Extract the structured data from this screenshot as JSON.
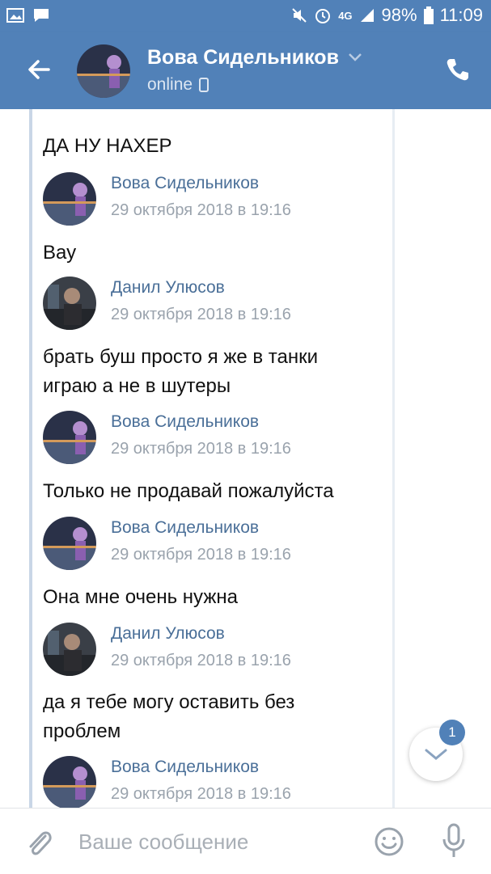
{
  "status_bar": {
    "network": "4G",
    "battery": "98%",
    "time": "11:09"
  },
  "header": {
    "contact_name": "Вова Сидельников",
    "status": "online",
    "back_icon": "arrow-left-icon",
    "call_icon": "phone-icon"
  },
  "chat": {
    "top_message": "ДА НУ НАХЕР",
    "messages": [
      {
        "sender": "Вова Сидельников",
        "date": "29 октября 2018 в 19:16",
        "lines": [
          "Вау"
        ]
      },
      {
        "sender": "Данил Улюсов",
        "date": "29 октября 2018 в 19:16",
        "lines": [
          "брать буш просто я же в танки",
          "играю а не в шутеры"
        ]
      },
      {
        "sender": "Вова Сидельников",
        "date": "29 октября 2018 в 19:16",
        "lines": [
          "Только не продавай пожалуйста"
        ]
      },
      {
        "sender": "Вова Сидельников",
        "date": "29 октября 2018 в 19:16",
        "lines": [
          "Она мне очень нужна"
        ]
      },
      {
        "sender": "Данил Улюсов",
        "date": "29 октября 2018 в 19:16",
        "lines": [
          "да я тебе могу оставить без",
          "проблем"
        ]
      },
      {
        "sender": "Вова Сидельников",
        "date": "29 октября 2018 в 19:16",
        "lines": []
      }
    ],
    "scroll_badge": "1"
  },
  "composer": {
    "placeholder": "Ваше сообщение"
  },
  "colors": {
    "accent": "#5181b8",
    "sender_name": "#4a6f98",
    "date": "#9aa3ad"
  }
}
